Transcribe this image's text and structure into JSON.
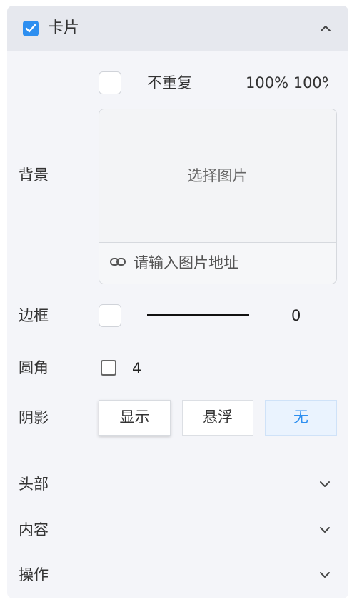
{
  "header": {
    "title": "卡片",
    "enabled": true
  },
  "background": {
    "label": "背景",
    "repeat_label": "不重复",
    "size_text": "100% 100%",
    "choose_image": "选择图片",
    "url_placeholder": "请输入图片地址"
  },
  "border": {
    "label": "边框",
    "value": "0"
  },
  "radius": {
    "label": "圆角",
    "value": "4"
  },
  "shadow": {
    "label": "阴影",
    "options": [
      "显示",
      "悬浮",
      "无"
    ],
    "selected": "无"
  },
  "sections": [
    {
      "label": "头部"
    },
    {
      "label": "内容"
    },
    {
      "label": "操作"
    }
  ],
  "colors": {
    "accent": "#2e8ff0",
    "panel_bg": "#f4f5f9",
    "header_bg": "#e6e8ee"
  }
}
